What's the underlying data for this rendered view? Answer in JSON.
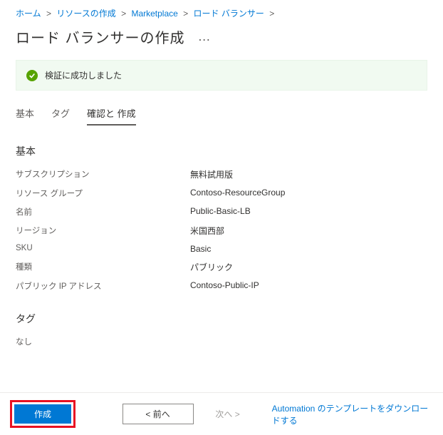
{
  "breadcrumb": {
    "items": [
      {
        "label": "ホーム"
      },
      {
        "label": "リソースの作成"
      },
      {
        "label": "Marketplace"
      },
      {
        "label": "ロード バランサー"
      }
    ]
  },
  "page": {
    "title": "ロード バランサーの作成"
  },
  "validation": {
    "message": "検証に成功しました"
  },
  "tabs": {
    "basic": "基本",
    "tags": "タグ",
    "review": "確認と 作成"
  },
  "sections": {
    "basic": {
      "title": "基本",
      "rows": {
        "subscription": {
          "label": "サブスクリプション",
          "value": "無料試用版"
        },
        "resourceGroup": {
          "label": "リソース グループ",
          "value": "Contoso-ResourceGroup"
        },
        "name": {
          "label": "名前",
          "value": "Public-Basic-LB"
        },
        "region": {
          "label": "リージョン",
          "value": "米国西部"
        },
        "sku": {
          "label": "SKU",
          "value": "Basic"
        },
        "type": {
          "label": "種類",
          "value": "パブリック"
        },
        "publicIp": {
          "label": "パブリック IP アドレス",
          "value": "Contoso-Public-IP"
        }
      }
    },
    "tags": {
      "title": "タグ",
      "empty": "なし"
    }
  },
  "footer": {
    "create": "作成",
    "prev": "<   前へ",
    "next": "次へ   >",
    "automationLink": "Automation のテンプレートをダウンロードする"
  }
}
